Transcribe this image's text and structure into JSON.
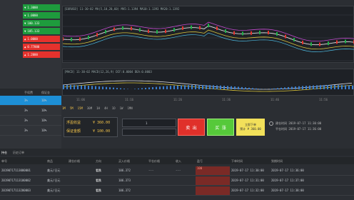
{
  "left_panel": {
    "quotes": [
      {
        "value": "1.3000",
        "color": "green"
      },
      {
        "value": "1.0000",
        "color": "green"
      },
      {
        "value": "100.133",
        "color": "green"
      },
      {
        "value": "105.133",
        "color": "green"
      },
      {
        "value": "1.0000",
        "color": "red"
      },
      {
        "value": "0.77000",
        "color": "red"
      },
      {
        "value": "1.2000",
        "color": "red"
      }
    ],
    "col_headers": [
      "",
      "手续费",
      "保证金"
    ],
    "rows": [
      {
        "a": "",
        "b": "3%",
        "c": "10%",
        "selected": true
      },
      {
        "a": "",
        "b": "3%",
        "c": "10%",
        "selected": false
      },
      {
        "a": "",
        "b": "3%",
        "c": "10%",
        "selected": false
      },
      {
        "a": "",
        "b": "3%",
        "c": "10%",
        "selected": false
      }
    ]
  },
  "chart": {
    "header": "[EURUSD] 11-30-02  MA(5,10,20,60)  MA5:1.1394  MA10:1.1393  MA20:1.1392",
    "sub_header": "[MACD] 11-30-02  MACD(12,26,9)  DIF:0.0004  DEA:0.0003",
    "time_labels": [
      "11:06",
      "11:16",
      "11:26",
      "11:36",
      "11:46",
      "11:56"
    ],
    "timeframes": [
      "1M",
      "5M",
      "15M",
      "30M",
      "1H",
      "4H",
      "1D",
      "1W",
      "1MN"
    ]
  },
  "order_panel": {
    "profit_label": "浮盈收益",
    "profit_value": "¥ 360.00",
    "guarantee_label": "保证金额",
    "guarantee_value": "¥ 100.00",
    "qty_value": "1",
    "sell_label": "卖 出",
    "buy_label": "买 涨",
    "confirm_line1": "立即下单",
    "confirm_line2": "预计 ¥ 360.00",
    "info_line1": "建仓时间 2019-07-17 11:30:00",
    "info_line2": "平仓时间 2019-07-17 11:36:00"
  },
  "bottom_tabs": [
    "持仓",
    "历史订单"
  ],
  "table": {
    "headers": [
      "单号",
      "商品",
      "建仓价格",
      "方向",
      "买入价格",
      "平仓价格",
      "收入",
      "盈亏",
      "下单时间",
      "到期时间"
    ],
    "rows": [
      {
        "id": "20190717113000001",
        "product": "美元/日元",
        "price": "",
        "dir": "看跌",
        "buy": "106.372",
        "close": "---",
        "income": "---",
        "pnl": "100",
        "time": "2019-07-17 11:30:00",
        "expire": "2019-07-17 11:36:00"
      },
      {
        "id": "20190717113100002",
        "product": "美元/日元",
        "price": "",
        "dir": "看跌",
        "buy": "106.373",
        "close": "",
        "income": "",
        "pnl": "",
        "time": "2019-07-17 11:31:00",
        "expire": "2019-07-17 11:37:00"
      },
      {
        "id": "20190717113200003",
        "product": "美元/日元",
        "price": "",
        "dir": "看跌",
        "buy": "106.372",
        "close": "",
        "income": "",
        "pnl": "",
        "time": "2019-07-17 11:32:00",
        "expire": "2019-07-17 11:38:00"
      }
    ]
  }
}
